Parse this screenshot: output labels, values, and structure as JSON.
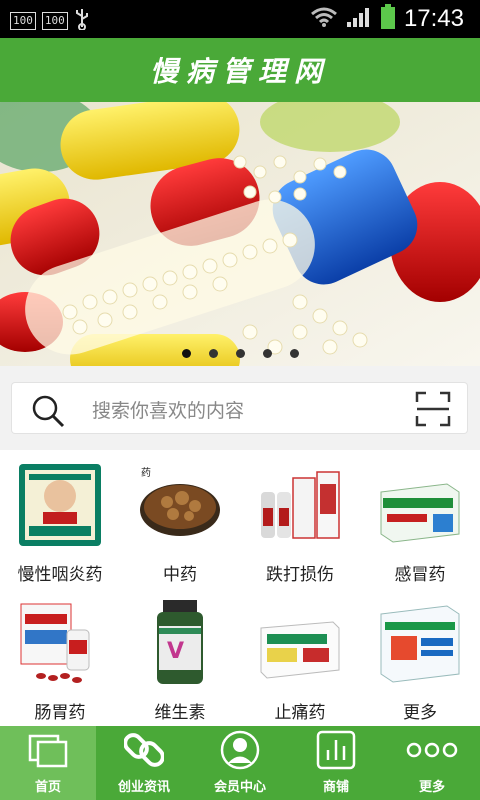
{
  "status_bar": {
    "badge1": "100",
    "badge2": "100",
    "time": "17:43"
  },
  "header": {
    "title": "慢病管理网"
  },
  "banner": {
    "slides_total": 5,
    "active_slide": 1
  },
  "search": {
    "placeholder": "搜索你喜欢的内容"
  },
  "categories": [
    {
      "label": "慢性咽炎药",
      "icon": "throat-lozenge-box-icon"
    },
    {
      "label": "中药",
      "icon": "herbal-medicine-bowl-icon"
    },
    {
      "label": "跌打损伤",
      "icon": "bruise-medicine-bottles-icon"
    },
    {
      "label": "感冒药",
      "icon": "cold-medicine-box-icon"
    },
    {
      "label": "肠胃药",
      "icon": "stomach-medicine-box-icon"
    },
    {
      "label": "维生素",
      "icon": "vitamin-bottle-icon"
    },
    {
      "label": "止痛药",
      "icon": "painkiller-box-icon"
    },
    {
      "label": "更多",
      "icon": "medicine-box-icon"
    }
  ],
  "tabbar": {
    "items": [
      {
        "label": "首页",
        "icon": "home-pages-icon",
        "active": true
      },
      {
        "label": "创业资讯",
        "icon": "link-icon",
        "active": false
      },
      {
        "label": "会员中心",
        "icon": "user-icon",
        "active": false
      },
      {
        "label": "商铺",
        "icon": "store-chart-icon",
        "active": false
      },
      {
        "label": "更多",
        "icon": "more-dots-icon",
        "active": false
      }
    ]
  },
  "colors": {
    "brand_green": "#4aa938",
    "active_tab": "#6fbf5a"
  }
}
